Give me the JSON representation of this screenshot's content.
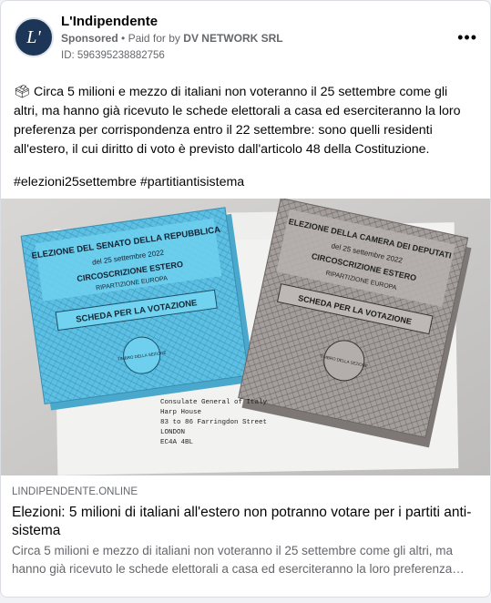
{
  "page": {
    "name": "L'Indipendente",
    "avatar_text": "L'"
  },
  "sponsor": {
    "label": "Sponsored",
    "separator": "•",
    "paid_prefix": "Paid for by",
    "payer": "DV NETWORK SRL",
    "id": "ID: 596395238882756"
  },
  "menu": {
    "more_label": "•••"
  },
  "post": {
    "text": "🗳 Circa 5 milioni e mezzo di italiani non voteranno il 25 settembre come gli altri, ma hanno già ricevuto le schede elettorali a casa ed eserciteranno la loro preferenza per corrispondenza entro il 22 settembre: sono quelli residenti all'estero, il cui diritto di voto è previsto dall'articolo 48 della Costituzione.",
    "hashtags": [
      "#elezioni25settembre",
      "#partitiantisistema"
    ]
  },
  "image": {
    "left_ballot": {
      "title": "ELEZIONE DEL SENATO DELLA REPUBBLICA",
      "date": "del 25 settembre 2022",
      "district": "CIRCOSCRIZIONE ESTERO",
      "area": "RIPARTIZIONE EUROPA",
      "label": "SCHEDA PER LA VOTAZIONE",
      "stamp": "TIMBRO DELLA SEZIONE"
    },
    "right_ballot": {
      "title": "ELEZIONE DELLA CAMERA DEI DEPUTATI",
      "date": "del 25 settembre 2022",
      "district": "CIRCOSCRIZIONE ESTERO",
      "area": "RIPARTIZIONE EUROPA",
      "label": "SCHEDA PER LA VOTAZIONE",
      "stamp": "TIMBRO DELLA SEZIONE"
    },
    "envelope_address": [
      "Consulate General of Italy",
      "Harp House",
      "83 to 86 Farringdon Street",
      "LONDON",
      "EC4A 4BL"
    ]
  },
  "link": {
    "domain": "LINDIPENDENTE.ONLINE",
    "title": "Elezioni: 5 milioni di italiani all'estero non potranno votare per i partiti anti-sistema",
    "description": "Circa 5 milioni e mezzo di italiani non voteranno il 25 settembre come gli altri, ma hanno già ricevuto le schede elettorali a casa ed eserciteranno la loro preferenza…"
  },
  "colors": {
    "blue_ballot": "#5ec3e6",
    "grey_ballot": "#9a9593",
    "text_secondary": "#65676b"
  }
}
